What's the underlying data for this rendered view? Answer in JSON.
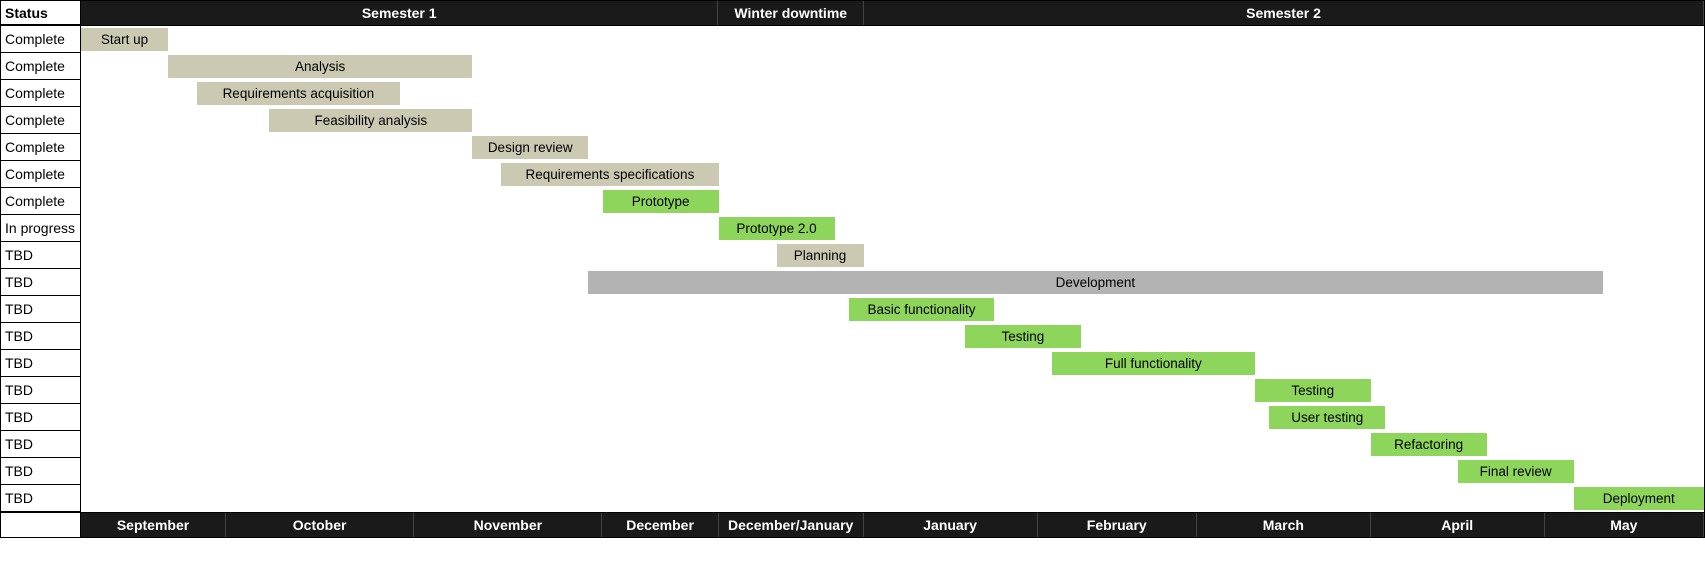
{
  "header": {
    "status_label": "Status",
    "sections": [
      {
        "label": "Semester 1",
        "units": 44
      },
      {
        "label": "Winter downtime",
        "units": 10
      },
      {
        "label": "Semester 2",
        "units": 58
      }
    ]
  },
  "footer": {
    "months": [
      {
        "label": "September",
        "units": 10
      },
      {
        "label": "October",
        "units": 13
      },
      {
        "label": "November",
        "units": 13
      },
      {
        "label": "December",
        "units": 8
      },
      {
        "label": "December/January",
        "units": 10
      },
      {
        "label": "January",
        "units": 12
      },
      {
        "label": "February",
        "units": 11
      },
      {
        "label": "March",
        "units": 12
      },
      {
        "label": "April",
        "units": 12
      },
      {
        "label": "May",
        "units": 11
      }
    ]
  },
  "rows": [
    {
      "status": "Complete",
      "label": "Start up",
      "start": 0,
      "span": 6,
      "class": "done"
    },
    {
      "status": "Complete",
      "label": "Analysis",
      "start": 6,
      "span": 21,
      "class": "done"
    },
    {
      "status": "Complete",
      "label": "Requirements acquisition",
      "start": 8,
      "span": 14,
      "class": "done"
    },
    {
      "status": "Complete",
      "label": "Feasibility analysis",
      "start": 13,
      "span": 14,
      "class": "done"
    },
    {
      "status": "Complete",
      "label": "Design review",
      "start": 27,
      "span": 8,
      "class": "done"
    },
    {
      "status": "Complete",
      "label": "Requirements specifications",
      "start": 29,
      "span": 15,
      "class": "done"
    },
    {
      "status": "Complete",
      "label": "Prototype",
      "start": 36,
      "span": 8,
      "class": "active"
    },
    {
      "status": "In progress",
      "label": "Prototype 2.0",
      "start": 44,
      "span": 8,
      "class": "active"
    },
    {
      "status": "TBD",
      "label": "Planning",
      "start": 48,
      "span": 6,
      "class": "done"
    },
    {
      "status": "TBD",
      "label": "Development",
      "start": 35,
      "span": 70,
      "class": "crit"
    },
    {
      "status": "TBD",
      "label": "Basic functionality",
      "start": 53,
      "span": 10,
      "class": "active"
    },
    {
      "status": "TBD",
      "label": "Testing",
      "start": 61,
      "span": 8,
      "class": "active"
    },
    {
      "status": "TBD",
      "label": "Full functionality",
      "start": 67,
      "span": 14,
      "class": "active"
    },
    {
      "status": "TBD",
      "label": "Testing",
      "start": 81,
      "span": 8,
      "class": "active"
    },
    {
      "status": "TBD",
      "label": "User testing",
      "start": 82,
      "span": 8,
      "class": "active"
    },
    {
      "status": "TBD",
      "label": "Refactoring",
      "start": 89,
      "span": 8,
      "class": "active"
    },
    {
      "status": "TBD",
      "label": "Final review",
      "start": 95,
      "span": 8,
      "class": "active"
    },
    {
      "status": "TBD",
      "label": "Deployment",
      "start": 103,
      "span": 9,
      "class": "active"
    }
  ],
  "total_units": 112,
  "chart_data": {
    "type": "gantt",
    "title": "",
    "x_axis_sections_top": [
      "Semester 1",
      "Winter downtime",
      "Semester 2"
    ],
    "x_axis_sections_bottom": [
      "September",
      "October",
      "November",
      "December",
      "December/January",
      "January",
      "February",
      "March",
      "April",
      "May"
    ],
    "y_axis_label": "Status",
    "tasks": [
      {
        "name": "Start up",
        "status": "Complete",
        "start_month": "September",
        "end_month": "September",
        "style": "done"
      },
      {
        "name": "Analysis",
        "status": "Complete",
        "start_month": "September",
        "end_month": "November",
        "style": "done"
      },
      {
        "name": "Requirements acquisition",
        "status": "Complete",
        "start_month": "September",
        "end_month": "October",
        "style": "done"
      },
      {
        "name": "Feasibility analysis",
        "status": "Complete",
        "start_month": "October",
        "end_month": "November",
        "style": "done"
      },
      {
        "name": "Design review",
        "status": "Complete",
        "start_month": "November",
        "end_month": "November",
        "style": "done"
      },
      {
        "name": "Requirements specifications",
        "status": "Complete",
        "start_month": "November",
        "end_month": "December",
        "style": "done"
      },
      {
        "name": "Prototype",
        "status": "Complete",
        "start_month": "December",
        "end_month": "December",
        "style": "active"
      },
      {
        "name": "Prototype 2.0",
        "status": "In progress",
        "start_month": "December/January",
        "end_month": "December/January",
        "style": "active"
      },
      {
        "name": "Planning",
        "status": "TBD",
        "start_month": "December/January",
        "end_month": "December/January",
        "style": "done"
      },
      {
        "name": "Development",
        "status": "TBD",
        "start_month": "November",
        "end_month": "May",
        "style": "crit"
      },
      {
        "name": "Basic functionality",
        "status": "TBD",
        "start_month": "December/January",
        "end_month": "January",
        "style": "active"
      },
      {
        "name": "Testing",
        "status": "TBD",
        "start_month": "January",
        "end_month": "February",
        "style": "active"
      },
      {
        "name": "Full functionality",
        "status": "TBD",
        "start_month": "February",
        "end_month": "March",
        "style": "active"
      },
      {
        "name": "Testing",
        "status": "TBD",
        "start_month": "March",
        "end_month": "April",
        "style": "active"
      },
      {
        "name": "User testing",
        "status": "TBD",
        "start_month": "March",
        "end_month": "April",
        "style": "active"
      },
      {
        "name": "Refactoring",
        "status": "TBD",
        "start_month": "April",
        "end_month": "April",
        "style": "active"
      },
      {
        "name": "Final review",
        "status": "TBD",
        "start_month": "April",
        "end_month": "May",
        "style": "active"
      },
      {
        "name": "Deployment",
        "status": "TBD",
        "start_month": "May",
        "end_month": "May",
        "style": "active"
      }
    ]
  }
}
